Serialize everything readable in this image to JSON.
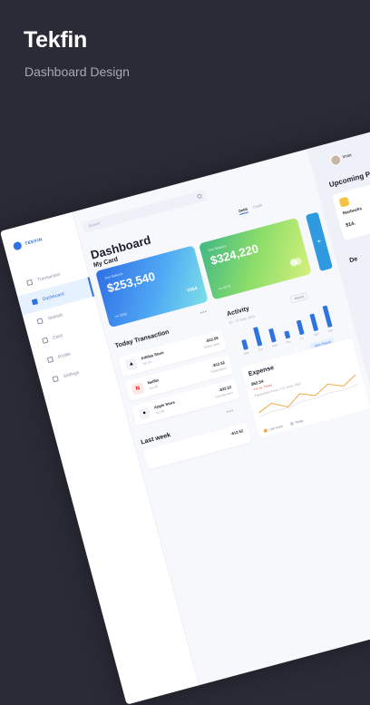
{
  "poster": {
    "title": "Tekfin",
    "subtitle": "Dashboard Design"
  },
  "app": {
    "logo": "TEKFIN",
    "nav": [
      {
        "label": "Transaction",
        "active": false
      },
      {
        "label": "Dashboard",
        "active": true
      },
      {
        "label": "Statistic",
        "active": false
      },
      {
        "label": "Card",
        "active": false
      },
      {
        "label": "Profile",
        "active": false
      },
      {
        "label": "Settings",
        "active": false
      }
    ],
    "search_placeholder": "Search",
    "page_title": "Dashboard",
    "tabs": [
      "Debit",
      "Credit"
    ],
    "my_card_label": "My Card",
    "cards": [
      {
        "caption": "Your Balance",
        "amount": "$253,540",
        "number": "•••• 3562",
        "brand": "VISA"
      },
      {
        "caption": "Your Balance",
        "amount": "$324,220",
        "number": "•••• 5678"
      }
    ],
    "add_label": "+",
    "today_label": "Today Transaction",
    "transactions": [
      {
        "logo": "▲",
        "name": "Adidas Store",
        "date": "Jun 25",
        "amount": "-$12.59",
        "kind": "Online Store"
      },
      {
        "logo": "N",
        "name": "Netflix",
        "date": "Jun 25",
        "amount": "-$12.52",
        "kind": "Subscription"
      },
      {
        "logo": "",
        "name": "Apple Store",
        "date": "Jun 25",
        "amount": "-$32.22",
        "kind": "Entertainment"
      }
    ],
    "last_week_label": "Last week",
    "last_week_amount": "-$12.52",
    "activity_label": "Activity",
    "activity_period": "Weekly",
    "activity_date": "20 - 27 June, 2021",
    "activity": {
      "chart_data": {
        "type": "bar",
        "categories": [
          "Mon",
          "Tue",
          "Wed",
          "Thu",
          "Fri",
          "Sat",
          "Sun"
        ],
        "values": [
          40,
          80,
          55,
          30,
          60,
          70,
          90
        ]
      }
    },
    "view_report": "View Report",
    "expense": {
      "title": "Expense",
      "amount": "$52.54",
      "delta": "-1% vs. Today",
      "range": "Transaction From 1-15 June, 2021",
      "legend": [
        "Last week",
        "Today"
      ],
      "colors": {
        "last_week": "#f4a742",
        "today": "#dfe3ee"
      },
      "chart_data": {
        "type": "line",
        "x": [
          1,
          2,
          3,
          4,
          5,
          6,
          7,
          8
        ],
        "series": [
          {
            "name": "Last week",
            "values": [
              12,
              18,
              10,
              20,
              14,
              22,
              16,
              24
            ]
          },
          {
            "name": "Today",
            "values": [
              8,
              10,
              9,
              12,
              11,
              13,
              12,
              14
            ]
          }
        ]
      }
    },
    "user_name": "Imaa",
    "upcoming_label": "Upcoming Payment",
    "upcoming": {
      "name": "Starbucks",
      "price": "$14."
    },
    "de_label": "De"
  }
}
